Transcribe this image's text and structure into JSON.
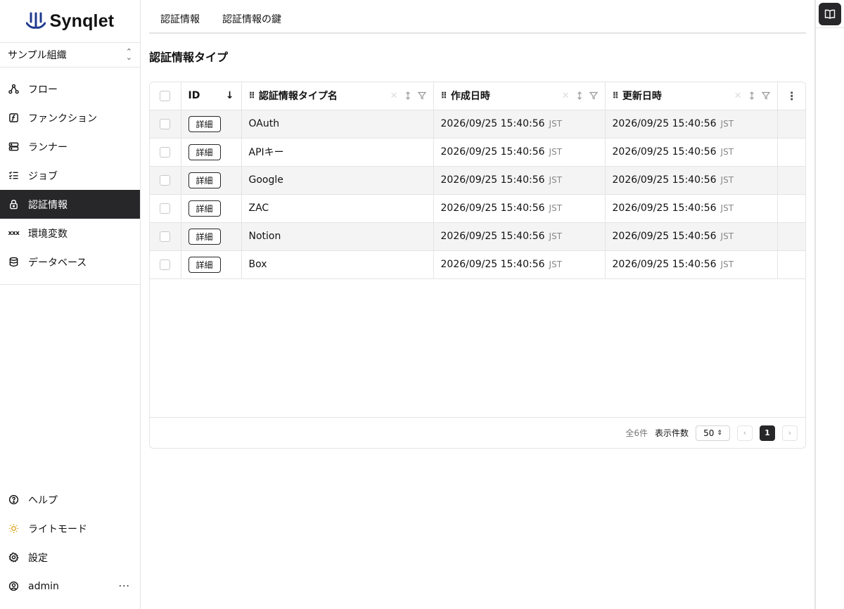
{
  "app": {
    "logo_text": "Synqlet"
  },
  "org": {
    "name": "サンプル組織"
  },
  "sidebar": {
    "items": [
      {
        "label": "フロー",
        "icon": "flow-icon"
      },
      {
        "label": "ファンクション",
        "icon": "function-icon"
      },
      {
        "label": "ランナー",
        "icon": "server-icon"
      },
      {
        "label": "ジョブ",
        "icon": "list-check-icon"
      },
      {
        "label": "認証情報",
        "icon": "lock-icon",
        "active": true
      },
      {
        "label": "環境変数",
        "icon": "variable-icon",
        "icon_text": "xxx"
      },
      {
        "label": "データベース",
        "icon": "database-icon"
      }
    ],
    "bottom": [
      {
        "label": "ヘルプ",
        "icon": "help-icon"
      },
      {
        "label": "ライトモード",
        "icon": "sun-icon"
      },
      {
        "label": "設定",
        "icon": "gear-icon"
      },
      {
        "label": "admin",
        "icon": "user-icon",
        "more": "···"
      }
    ]
  },
  "tabs": [
    "認証情報",
    "認証情報の鍵"
  ],
  "page": {
    "title": "認証情報タイプ"
  },
  "table": {
    "columns": [
      {
        "label": "ID",
        "sort_icon": "↓"
      },
      {
        "label": "認証情報タイプ名"
      },
      {
        "label": "作成日時"
      },
      {
        "label": "更新日時"
      }
    ],
    "detail_label": "詳細",
    "tz": "JST",
    "rows": [
      {
        "name": "OAuth",
        "created": "2026/09/25 15:40:56",
        "updated": "2026/09/25 15:40:56"
      },
      {
        "name": "APIキー",
        "created": "2026/09/25 15:40:56",
        "updated": "2026/09/25 15:40:56"
      },
      {
        "name": "Google",
        "created": "2026/09/25 15:40:56",
        "updated": "2026/09/25 15:40:56"
      },
      {
        "name": "ZAC",
        "created": "2026/09/25 15:40:56",
        "updated": "2026/09/25 15:40:56"
      },
      {
        "name": "Notion",
        "created": "2026/09/25 15:40:56",
        "updated": "2026/09/25 15:40:56"
      },
      {
        "name": "Box",
        "created": "2026/09/25 15:40:56",
        "updated": "2026/09/25 15:40:56"
      }
    ]
  },
  "pagination": {
    "total": "全6件",
    "page_size_label": "表示件数",
    "page_size": "50",
    "prev": "‹",
    "current": "1",
    "next": "›"
  },
  "colors": {
    "accent": "#27272a",
    "border": "#e4e4e7",
    "logo": "#1f3b8f"
  }
}
